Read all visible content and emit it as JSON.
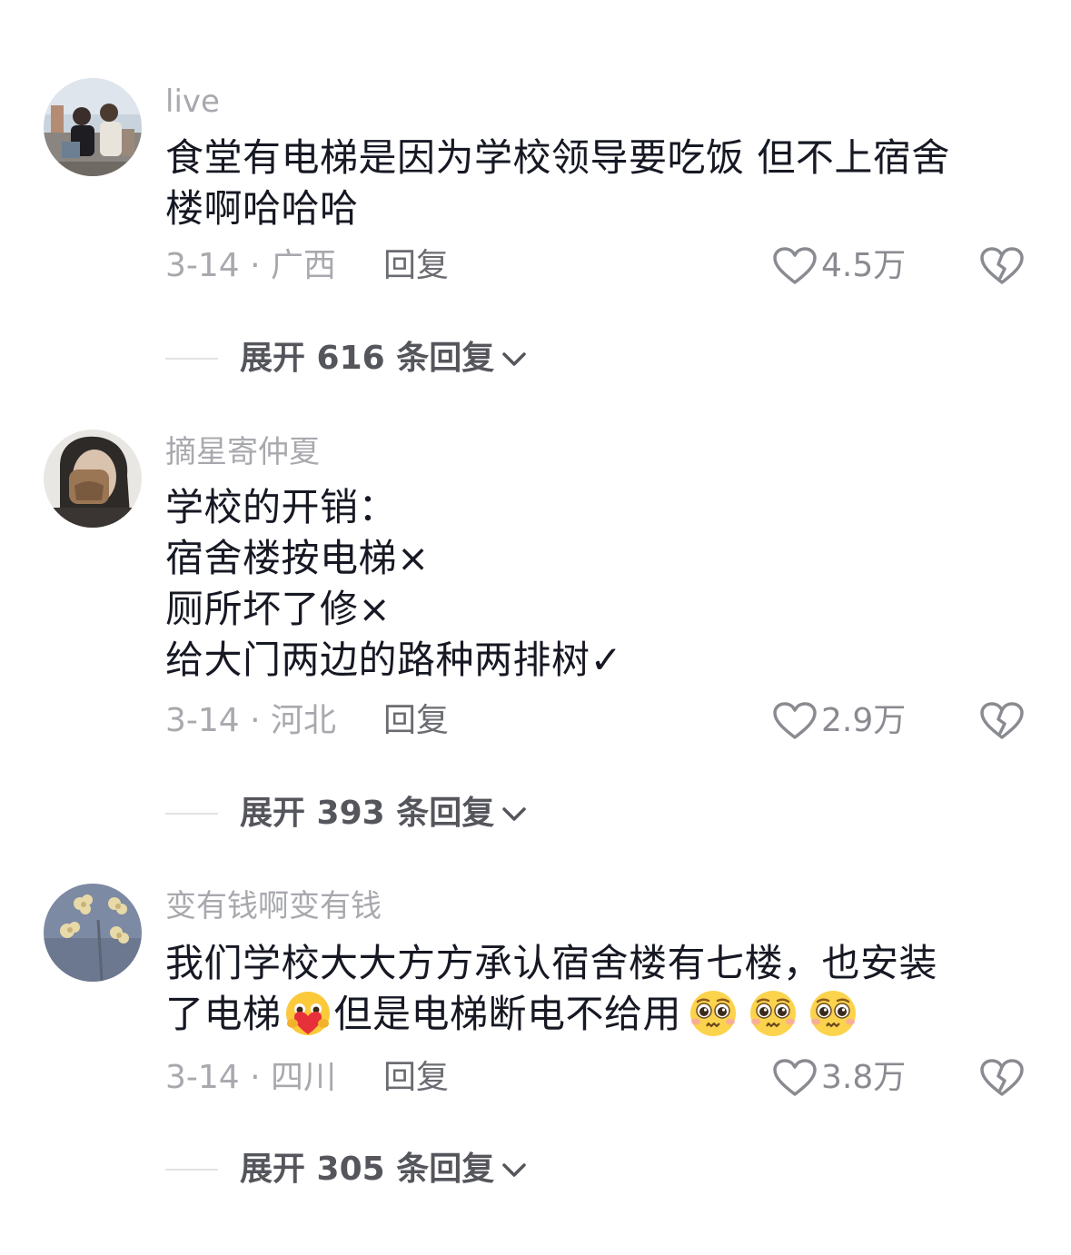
{
  "comments": [
    {
      "username": "live",
      "content_lines": [
        "食堂有电梯是因为学校领导要吃饭 但不上宿舍",
        "楼啊哈哈哈"
      ],
      "date_location": "3-14 · 广西",
      "reply_label": "回复",
      "likes": "4.5万",
      "expand_label": "展开 616 条回复",
      "avatar_icon": "photo-avatar-group",
      "like_icon": "heart-outline-icon",
      "dislike_icon": "broken-heart-icon"
    },
    {
      "username": "摘星寄仲夏",
      "content_lines": [
        "学校的开销：",
        "宿舍楼按电梯×",
        "厕所坏了修×",
        "给大门两边的路种两排树✓"
      ],
      "date_location": "3-14 · 河北",
      "reply_label": "回复",
      "likes": "2.9万",
      "expand_label": "展开 393 条回复",
      "avatar_icon": "photo-avatar-selfie",
      "like_icon": "heart-outline-icon",
      "dislike_icon": "broken-heart-icon"
    },
    {
      "username": "变有钱啊变有钱",
      "content_lines": [
        "我们学校大大方方承认宿舍楼有七楼，也安装",
        "了电梯",
        "但是电梯断电不给用"
      ],
      "date_location": "3-14 · 四川",
      "reply_label": "回复",
      "likes": "3.8万",
      "expand_label": "展开 305 条回复",
      "avatar_icon": "photo-avatar-flowers",
      "emoji_icons": [
        "heart-hug-emoji",
        "pleading-face-emoji"
      ],
      "like_icon": "heart-outline-icon",
      "dislike_icon": "broken-heart-icon"
    }
  ],
  "colors": {
    "username": "#a8a9ae",
    "content": "#161823",
    "meta": "#a8a9ae",
    "reply": "#6b6c72",
    "expand": "#55565c",
    "divider": "#e3e3e6"
  }
}
